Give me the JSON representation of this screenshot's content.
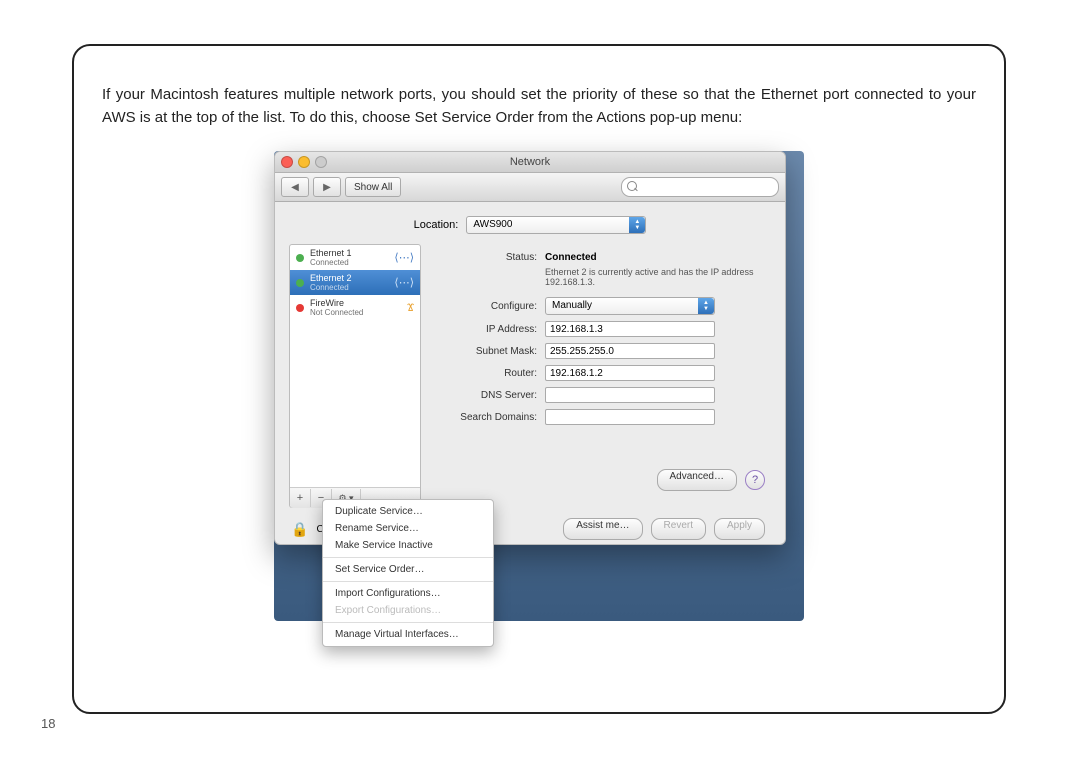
{
  "instruction": "If your Macintosh features multiple network ports, you should set the priority of these so that the Ethernet port connected to your AWS is at the top of the list. To do this, choose Set Service Order from the Actions pop-up menu:",
  "page_number": "18",
  "window": {
    "title": "Network",
    "show_all": "Show All",
    "location_label": "Location:",
    "location_value": "AWS900"
  },
  "sidebar": {
    "items": [
      {
        "name": "Ethernet 1",
        "status": "Connected",
        "dot": "green",
        "icon": "eth"
      },
      {
        "name": "Ethernet 2",
        "status": "Connected",
        "dot": "green",
        "icon": "eth",
        "selected": true
      },
      {
        "name": "FireWire",
        "status": "Not Connected",
        "dot": "red",
        "icon": "fw"
      }
    ],
    "plus": "+",
    "minus": "−",
    "gear": "⚙ ▾"
  },
  "detail": {
    "status_label": "Status:",
    "status_value": "Connected",
    "status_note": "Ethernet 2 is currently active and has the IP address 192.168.1.3.",
    "configure_label": "Configure:",
    "configure_value": "Manually",
    "ip_label": "IP Address:",
    "ip_value": "192.168.1.3",
    "subnet_label": "Subnet Mask:",
    "subnet_value": "255.255.255.0",
    "router_label": "Router:",
    "router_value": "192.168.1.2",
    "dns_label": "DNS Server:",
    "dns_value": "",
    "search_label": "Search Domains:",
    "search_value": "",
    "advanced": "Advanced…",
    "help": "?"
  },
  "bottom": {
    "lock_text": "Clic",
    "assist": "Assist me…",
    "revert": "Revert",
    "apply": "Apply"
  },
  "menu": {
    "duplicate": "Duplicate Service…",
    "rename": "Rename Service…",
    "inactive": "Make Service Inactive",
    "order": "Set Service Order…",
    "import": "Import Configurations…",
    "export": "Export Configurations…",
    "virtual": "Manage Virtual Interfaces…"
  }
}
